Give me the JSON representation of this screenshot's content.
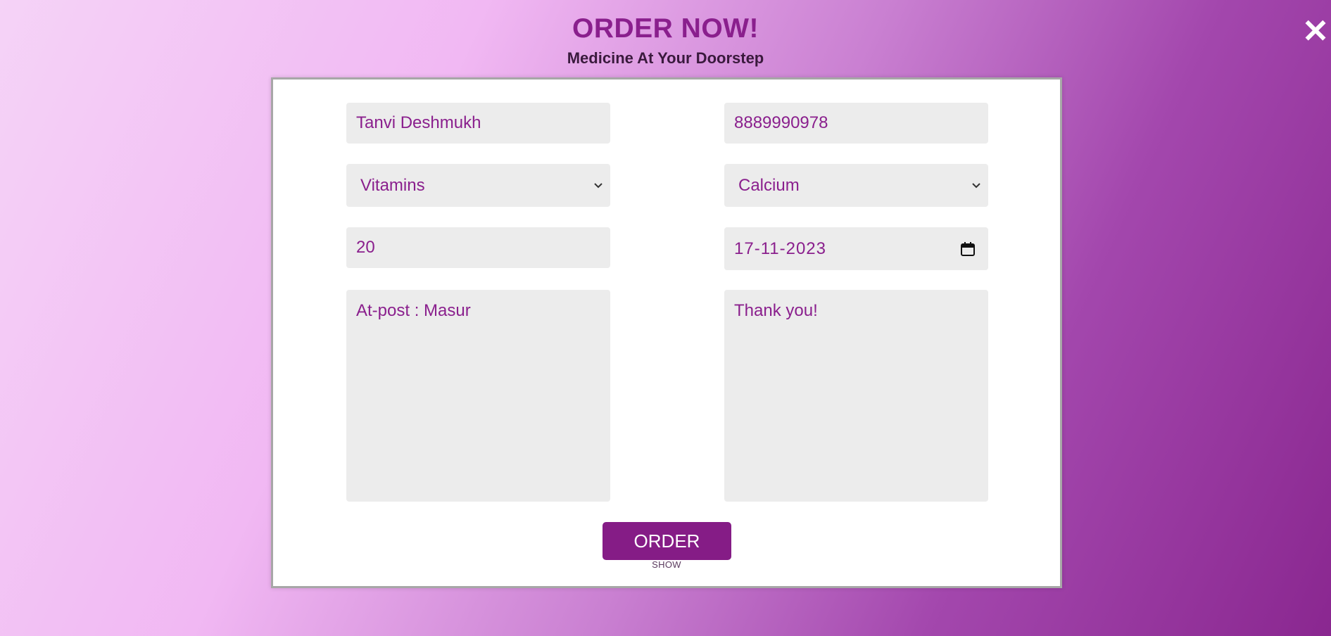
{
  "header": {
    "title": "ORDER NOW!",
    "subtitle": "Medicine At Your Doorstep"
  },
  "close": {
    "label": "✕",
    "icon": "close-icon"
  },
  "form": {
    "name": {
      "value": "Tanvi Deshmukh"
    },
    "phone": {
      "value": "8889990978"
    },
    "category": {
      "selected": "Vitamins",
      "icon": "chevron-down-icon"
    },
    "product": {
      "selected": "Calcium",
      "icon": "chevron-down-icon"
    },
    "quantity": {
      "value": "20"
    },
    "date": {
      "value": "17-11-2023",
      "icon": "calendar-icon"
    },
    "address": {
      "value": "At-post : Masur"
    },
    "message": {
      "value": "Thank you!"
    }
  },
  "actions": {
    "order_label": "ORDER",
    "show_label": "SHOW"
  },
  "colors": {
    "accent": "#851c86",
    "field_bg": "#ececec",
    "field_text": "#8a1f8d"
  }
}
